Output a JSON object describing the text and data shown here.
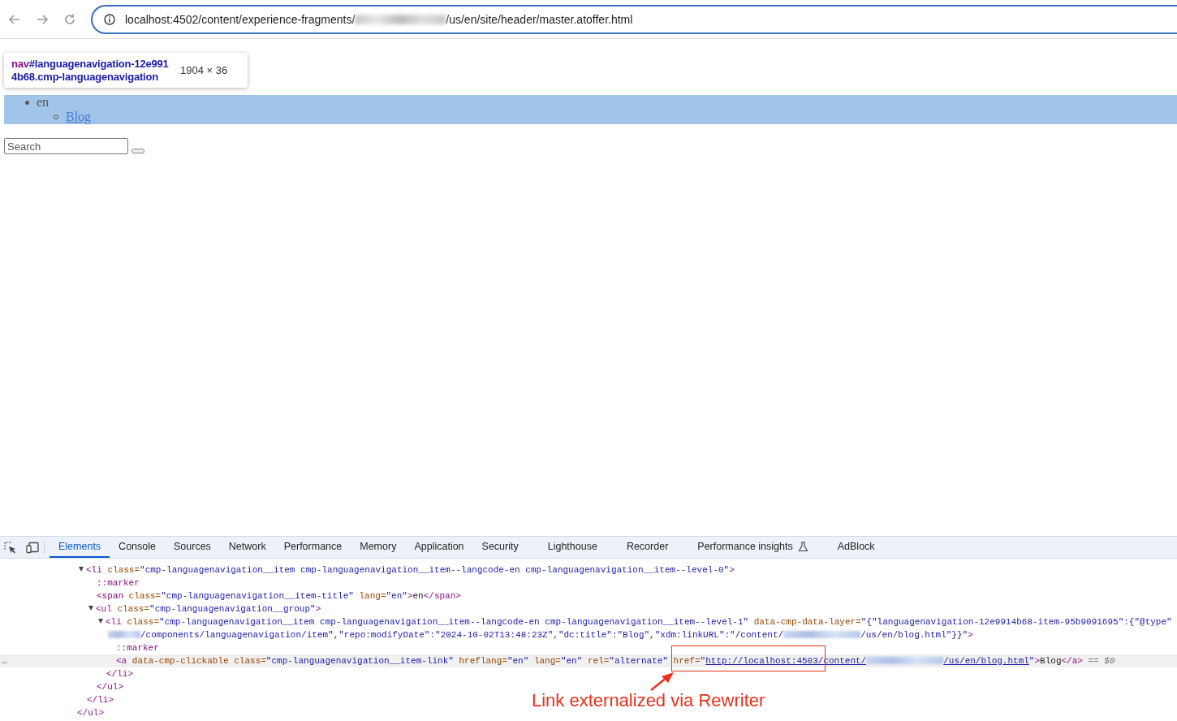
{
  "browser": {
    "address": [
      {
        "kind": "text",
        "text": "localhost:4502/content/experience-fragments/"
      },
      {
        "kind": "blur"
      },
      {
        "kind": "text",
        "text": "/us/en/site/header/master.atoffer.html"
      }
    ]
  },
  "page": {
    "tooltip": {
      "tag": "nav",
      "selector": "#languagenavigation-12e9914b68.cmp-languagenavigation",
      "size": "1904 × 36"
    },
    "nav": [
      {
        "label": "en",
        "children": [
          {
            "label": "Blog"
          }
        ]
      }
    ],
    "search": {
      "placeholder": "Search"
    }
  },
  "devtools": {
    "tabs": [
      {
        "label": "Elements",
        "selected": true
      },
      {
        "label": "Console",
        "selected": false
      },
      {
        "label": "Sources",
        "selected": false
      },
      {
        "label": "Network",
        "selected": false
      },
      {
        "label": "Performance",
        "selected": false
      },
      {
        "label": "Memory",
        "selected": false
      },
      {
        "label": "Application",
        "selected": false
      },
      {
        "label": "Security",
        "selected": false
      },
      {
        "label": "Lighthouse",
        "selected": false
      },
      {
        "label": "Recorder",
        "selected": false
      },
      {
        "label": "Performance insights",
        "selected": false,
        "experimental": true
      },
      {
        "label": "AdBlock",
        "selected": false
      }
    ],
    "tree": [
      {
        "expanded": true,
        "close": [
          {
            "kind": "tag",
            "text": "</ul>"
          }
        ],
        "children": [
          {
            "expanded": true,
            "selected": false,
            "open": [
              {
                "kind": "tag",
                "text": "<li"
              },
              {
                "kind": "attr",
                "text": " class="
              },
              {
                "kind": "value",
                "text": "\"cmp-languagenavigation__item cmp-languagenavigation__item--langcode-en cmp-languagenavigation__item--level-0\""
              },
              {
                "kind": "tag",
                "text": ">"
              }
            ],
            "close": [
              {
                "kind": "tag",
                "text": "</li>"
              }
            ],
            "children": [
              {
                "selected": false,
                "open": [
                  {
                    "kind": "pseudo",
                    "text": "::marker"
                  }
                ]
              },
              {
                "selected": false,
                "open": [
                  {
                    "kind": "tag",
                    "text": "<span"
                  },
                  {
                    "kind": "attr",
                    "text": " class="
                  },
                  {
                    "kind": "value",
                    "text": "\"cmp-languagenavigation__item-title\""
                  },
                  {
                    "kind": "attr",
                    "text": " lang="
                  },
                  {
                    "kind": "value",
                    "text": "\"en\""
                  },
                  {
                    "kind": "tag",
                    "text": ">"
                  },
                  {
                    "kind": "plain",
                    "text": "en"
                  },
                  {
                    "kind": "tag",
                    "text": "</span>"
                  }
                ]
              },
              {
                "expanded": true,
                "selected": false,
                "open": [
                  {
                    "kind": "tag",
                    "text": "<ul"
                  },
                  {
                    "kind": "attr",
                    "text": " class="
                  },
                  {
                    "kind": "value",
                    "text": "\"cmp-languagenavigation__group\""
                  },
                  {
                    "kind": "tag",
                    "text": ">"
                  }
                ],
                "close": [
                  {
                    "kind": "tag",
                    "text": "</ul>"
                  }
                ],
                "children": [
                  {
                    "expanded": true,
                    "selected": false,
                    "open": [
                      {
                        "kind": "tag",
                        "text": "<li"
                      },
                      {
                        "kind": "attr",
                        "text": " class="
                      },
                      {
                        "kind": "value",
                        "text": "\"cmp-languagenavigation__item cmp-languagenavigation__item--langcode-en cmp-languagenavigation__item--level-1\""
                      },
                      {
                        "kind": "attr",
                        "text": " data-cmp-data-layer="
                      },
                      {
                        "kind": "value",
                        "text": "\"{\"languagenavigation-12e9914b68-item-95b9091695\":{\"@type\""
                      },
                      {
                        "kind": "wrap"
                      },
                      {
                        "kind": "blur"
                      },
                      {
                        "kind": "value",
                        "text": "/components/languagenavigation/item\",\"repo:modifyDate\":\"2024-10-02T13:48:23Z\",\"dc:title\":\"Blog\",\"xdm:linkURL\":\"/content/"
                      },
                      {
                        "kind": "blur"
                      },
                      {
                        "kind": "value",
                        "text": "/us/en/blog.html\"}}\""
                      },
                      {
                        "kind": "tag",
                        "text": ">"
                      }
                    ],
                    "close": [
                      {
                        "kind": "tag",
                        "text": "</li>"
                      }
                    ],
                    "children": [
                      {
                        "selected": false,
                        "open": [
                          {
                            "kind": "pseudo",
                            "text": "::marker"
                          }
                        ]
                      },
                      {
                        "selected": true,
                        "gutter": "…",
                        "open": [
                          {
                            "kind": "tag",
                            "text": "<a"
                          },
                          {
                            "kind": "attr",
                            "text": " data-cmp-clickable class="
                          },
                          {
                            "kind": "value",
                            "text": "\"cmp-languagenavigation__item-link\""
                          },
                          {
                            "kind": "attr",
                            "text": " hreflang="
                          },
                          {
                            "kind": "value",
                            "text": "\"en\""
                          },
                          {
                            "kind": "attr",
                            "text": " lang="
                          },
                          {
                            "kind": "value",
                            "text": "\"en\""
                          },
                          {
                            "kind": "attr",
                            "text": " rel="
                          },
                          {
                            "kind": "value",
                            "text": "\"alternate\""
                          },
                          {
                            "kind": "attr",
                            "text": " href="
                          },
                          {
                            "kind": "value",
                            "text": "\""
                          },
                          {
                            "kind": "link",
                            "text": "http://localhost:4503/content/"
                          },
                          {
                            "kind": "blur"
                          },
                          {
                            "kind": "link",
                            "text": "/us/en/blog.html"
                          },
                          {
                            "kind": "value",
                            "text": "\""
                          },
                          {
                            "kind": "tag",
                            "text": ">"
                          },
                          {
                            "kind": "plain",
                            "text": "Blog"
                          },
                          {
                            "kind": "tag",
                            "text": "</a>"
                          },
                          {
                            "kind": "hint",
                            "text": " == $0"
                          }
                        ]
                      }
                    ]
                  }
                ]
              }
            ]
          }
        ]
      }
    ]
  },
  "annotation": {
    "text": "Link externalized via Rewriter"
  }
}
